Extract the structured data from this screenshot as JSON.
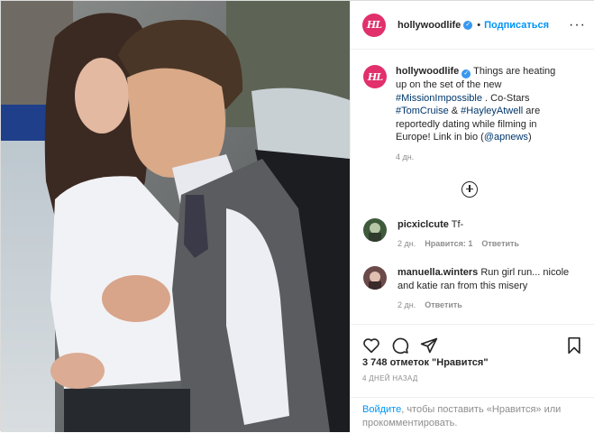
{
  "post": {
    "account": "hollywoodlife",
    "avatar_text": "HL",
    "follow_label": "Подписаться",
    "more_icon": "more-horizontal-icon",
    "caption_parts": [
      {
        "type": "text",
        "value": "Things are heating up on the set of the new "
      },
      {
        "type": "tag",
        "value": "#MissionImpossible"
      },
      {
        "type": "text",
        "value": " . Co-Stars "
      },
      {
        "type": "tag",
        "value": "#TomCruise"
      },
      {
        "type": "text",
        "value": " & "
      },
      {
        "type": "tag",
        "value": "#HayleyAtwell"
      },
      {
        "type": "text",
        "value": " are reportedly dating while filming in Europe! Link in bio ("
      },
      {
        "type": "tag",
        "value": "@apnews"
      },
      {
        "type": "text",
        "value": ")"
      }
    ],
    "caption_time": "4 дн.",
    "load_more_icon": "plus-circle-icon"
  },
  "comments": [
    {
      "user": "picxiclcute",
      "text": "Tf-",
      "time": "2 дн.",
      "likes": "Нравится: 1",
      "reply": "Ответить",
      "avatar_color": "#3e5a3a"
    },
    {
      "user": "manuella.winters",
      "text": "Run girl run... nicole and katie ran from this misery",
      "time": "2 дн.",
      "likes": "",
      "reply": "Ответить",
      "avatar_color": "#6b4a4a"
    }
  ],
  "actions": {
    "icons": [
      "heart-icon",
      "comment-icon",
      "share-icon",
      "bookmark-icon"
    ],
    "likes_count": "3 748 отметок \"Нравится\"",
    "date": "4 ДНЕЙ НАЗАД"
  },
  "login_prompt": {
    "link": "Войдите",
    "text": ", чтобы поставить «Нравится» или прокомментировать."
  },
  "colors": {
    "link_blue": "#0095f6",
    "hashtag": "#00376b",
    "muted": "#8e8e8e",
    "avatar_brand": "#e1306c"
  }
}
